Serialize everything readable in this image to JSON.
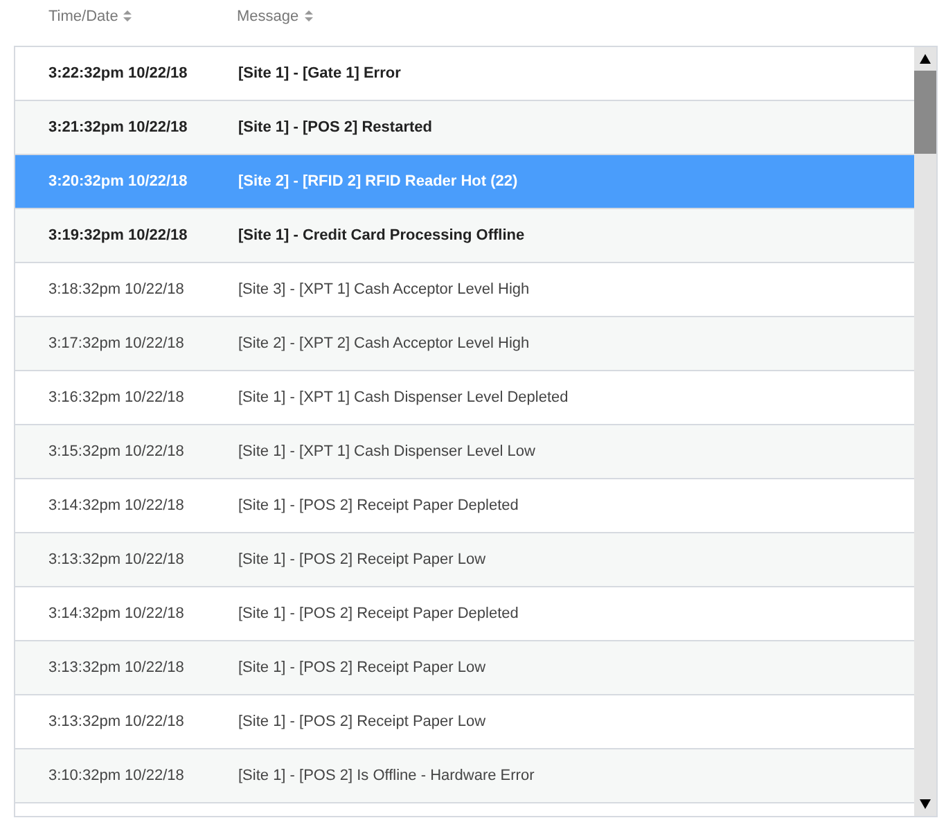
{
  "columns": [
    {
      "label": "Time/Date"
    },
    {
      "label": "Message"
    }
  ],
  "rows": [
    {
      "time": "3:22:32pm 10/22/18",
      "message": "[Site 1] - [Gate 1] Error",
      "unread": true,
      "selected": false
    },
    {
      "time": "3:21:32pm 10/22/18",
      "message": "[Site 1] - [POS 2] Restarted",
      "unread": true,
      "selected": false
    },
    {
      "time": "3:20:32pm 10/22/18",
      "message": "[Site 2] - [RFID 2] RFID Reader Hot (22)",
      "unread": true,
      "selected": true
    },
    {
      "time": "3:19:32pm 10/22/18",
      "message": "[Site 1] - Credit Card Processing Offline",
      "unread": true,
      "selected": false
    },
    {
      "time": "3:18:32pm 10/22/18",
      "message": "[Site 3] - [XPT 1] Cash Acceptor Level High",
      "unread": false,
      "selected": false
    },
    {
      "time": "3:17:32pm 10/22/18",
      "message": "[Site 2] - [XPT 2] Cash Acceptor Level High",
      "unread": false,
      "selected": false
    },
    {
      "time": "3:16:32pm 10/22/18",
      "message": "[Site 1] - [XPT 1] Cash Dispenser Level Depleted",
      "unread": false,
      "selected": false
    },
    {
      "time": "3:15:32pm 10/22/18",
      "message": "[Site 1] - [XPT 1] Cash Dispenser Level Low",
      "unread": false,
      "selected": false
    },
    {
      "time": "3:14:32pm 10/22/18",
      "message": "[Site 1] - [POS 2] Receipt Paper Depleted",
      "unread": false,
      "selected": false
    },
    {
      "time": "3:13:32pm 10/22/18",
      "message": "[Site 1] - [POS 2] Receipt Paper Low",
      "unread": false,
      "selected": false
    },
    {
      "time": "3:14:32pm 10/22/18",
      "message": "[Site 1] - [POS 2] Receipt Paper Depleted",
      "unread": false,
      "selected": false
    },
    {
      "time": "3:13:32pm 10/22/18",
      "message": "[Site 1] - [POS 2] Receipt Paper Low",
      "unread": false,
      "selected": false
    },
    {
      "time": "3:13:32pm 10/22/18",
      "message": "[Site 1] - [POS 2] Receipt Paper Low",
      "unread": false,
      "selected": false
    },
    {
      "time": "3:10:32pm 10/22/18",
      "message": "[Site 1] - [POS 2] Is Offline - Hardware Error",
      "unread": false,
      "selected": false
    }
  ]
}
